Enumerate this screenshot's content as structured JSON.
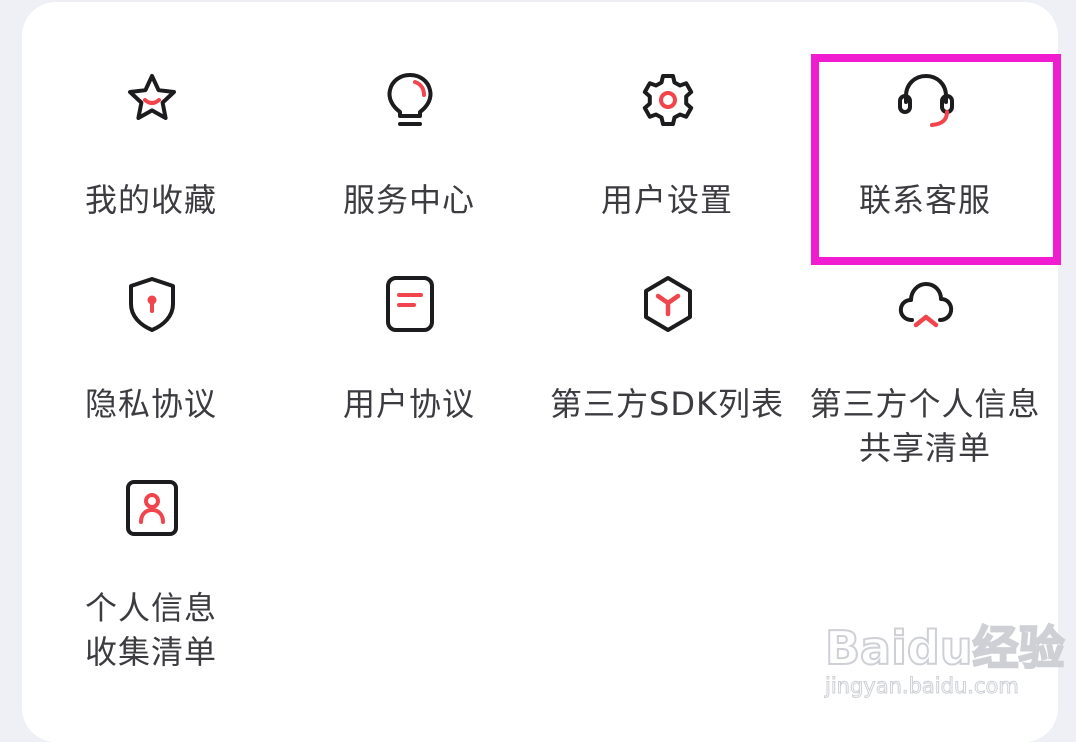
{
  "menu": {
    "items": [
      {
        "label": "我的收藏",
        "icon": "star-icon"
      },
      {
        "label": "服务中心",
        "icon": "lightbulb-icon"
      },
      {
        "label": "用户设置",
        "icon": "gear-icon"
      },
      {
        "label": "联系客服",
        "icon": "headset-icon"
      },
      {
        "label": "隐私协议",
        "icon": "shield-icon"
      },
      {
        "label": "用户协议",
        "icon": "document-icon"
      },
      {
        "label": "第三方SDK列表",
        "icon": "cube-icon"
      },
      {
        "label_line1": "第三方个人信息",
        "label_line2": "共享清单",
        "icon": "cloud-icon"
      },
      {
        "label_line1": "个人信息",
        "label_line2": "收集清单",
        "icon": "person-card-icon"
      }
    ]
  },
  "watermark": {
    "logo": "Baidu经验",
    "url": "jingyan.baidu.com"
  },
  "colors": {
    "icon_stroke": "#1c1c1e",
    "icon_accent": "#f2444c",
    "highlight": "#f11bd0",
    "label": "#3b3b40"
  }
}
